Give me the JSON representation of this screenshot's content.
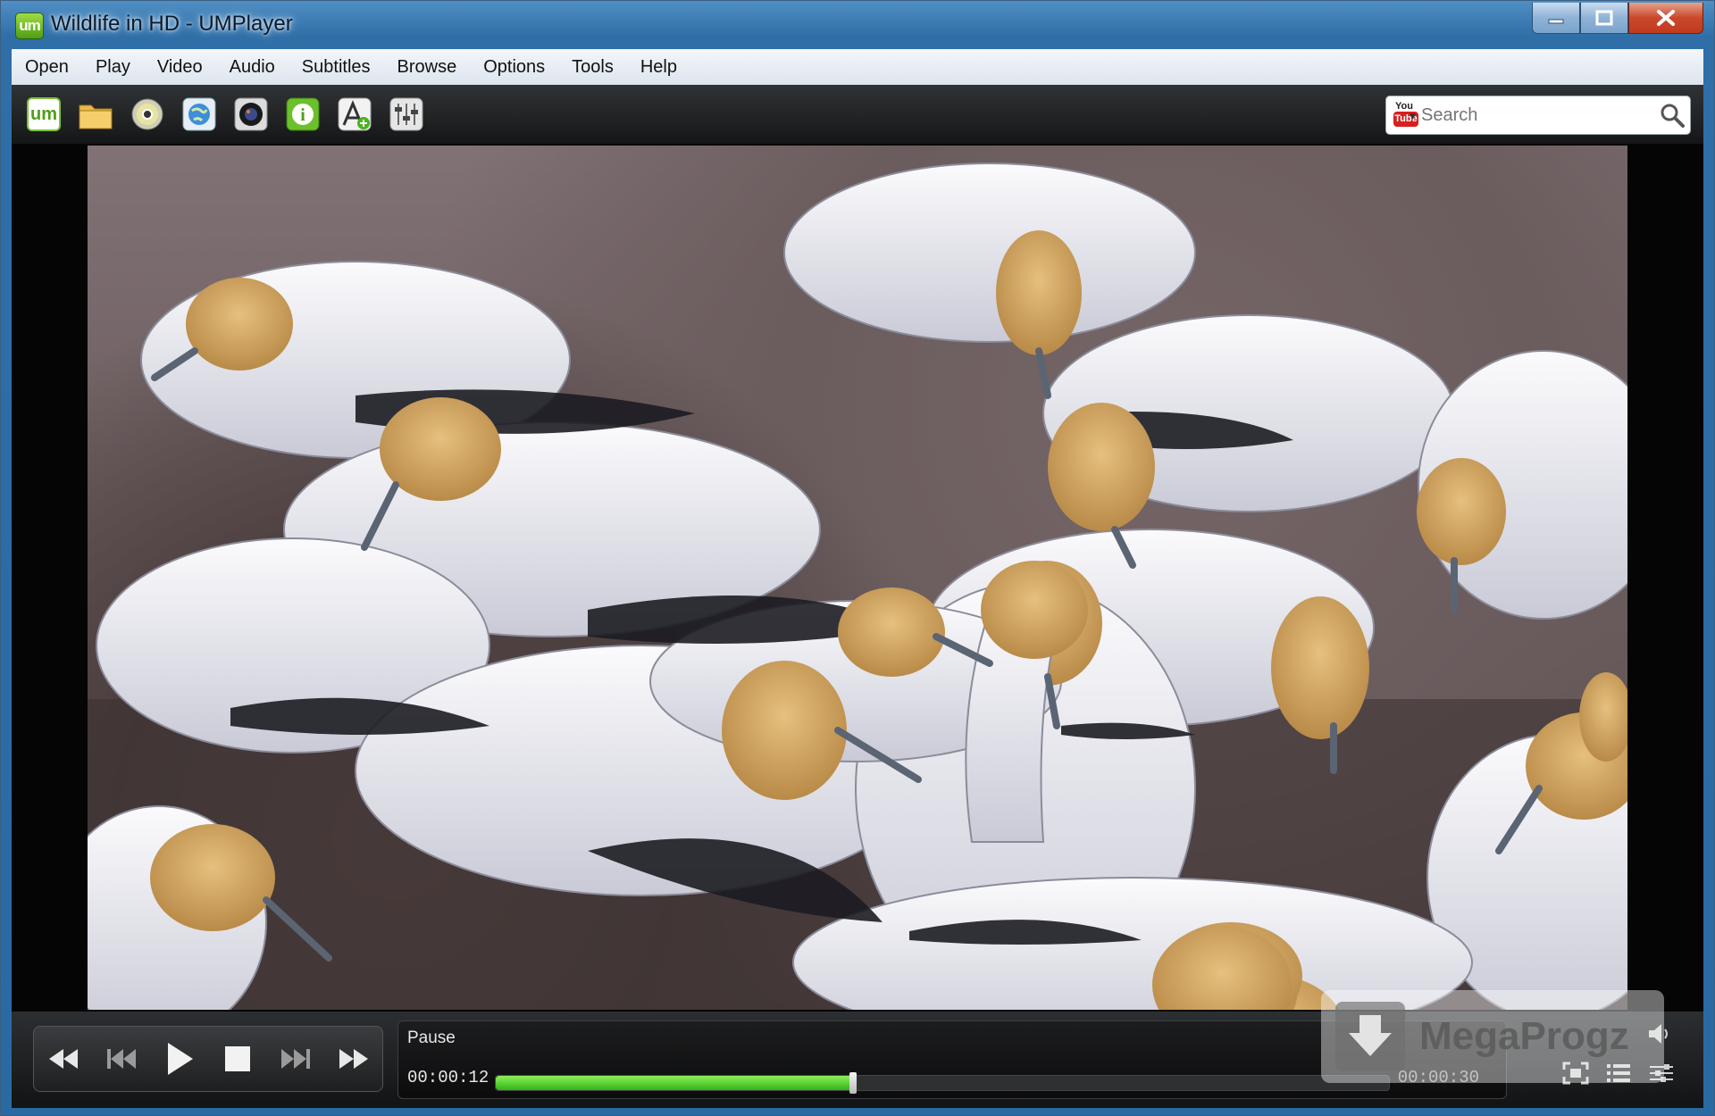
{
  "window": {
    "title": "Wildlife in HD - UMPlayer",
    "app_icon_text": "um"
  },
  "menu": [
    "Open",
    "Play",
    "Video",
    "Audio",
    "Subtitles",
    "Browse",
    "Options",
    "Tools",
    "Help"
  ],
  "toolbar": {
    "buttons": [
      "umplayer-logo-icon",
      "folder-icon",
      "disc-icon",
      "globe-icon",
      "camera-lens-icon",
      "info-icon",
      "font-add-icon",
      "equalizer-icon"
    ]
  },
  "search": {
    "provider_top": "You",
    "provider_bottom": "Tube",
    "placeholder": "Search"
  },
  "controls": {
    "status": "Pause",
    "current_time": "00:00:12",
    "total_time": "00:00:30",
    "progress": 0.4
  },
  "watermark": {
    "text": "MegaProgz"
  },
  "colors": {
    "accent_green": "#2fb417",
    "titlebar_blue": "#2f6ea7",
    "close_red": "#c9482b"
  }
}
